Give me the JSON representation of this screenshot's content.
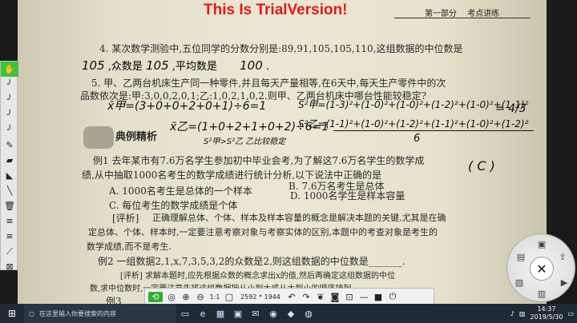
{
  "watermark": "This Is TrialVersion!",
  "header": {
    "section": "第一部分",
    "title": "考点讲练"
  },
  "page": {
    "q4_text": "4. 某次数学测验中,五位同学的分数分别是:89,91,105,105,110,这组数据的中位数是",
    "q4_median": "105",
    "q4_mode_label": ",众数是",
    "q4_mode": "105",
    "q4_mean_label": ",平均数是",
    "q4_mean": "100",
    "q4_end": ".",
    "q5_text": "5. 甲、乙两台机床生产同一种零件,并且每天产量相等,在6天中,每天生产零件中的次",
    "q5_text2": "品数依次是:甲:3,0,0,2,0,1;乙:1,0,2,1,0,2.则甲、乙两台机床中哪台性能较稳定?",
    "hw_line1": "x̄甲=(3+0+0+2+0+1)÷6=1",
    "hw_formula1": "S²甲=(1-3)²+(1-0)²+(1-0)²+(1-2)²+(1-0)²+(1-1)²",
    "hw_fraction1": "= 4/3",
    "hw_line2": "x̄乙=(1+0+2+1+0+2)÷6=1",
    "hw_formula2": "S²乙=(1-1)²+(1-0)²+(1-2)²+(1-1)²+(1-0)²+(1-2)²",
    "hw_denominator": "6",
    "hw_note": "S²甲>S²乙 乙比较稳定",
    "section_label": "典例精析",
    "ex1_text": "例1  去年某市有7.6万名学生参加初中毕业会考,为了解这7.6万名学生的数学成",
    "ex1_text2": "绩,从中抽取1000名考生的数学成绩进行统计分析,以下说法中正确的是",
    "ex1_answer": "( C )",
    "ex1_a": "A. 1000名考生是总体的一个样本",
    "ex1_b": "B. 7.6万名考生是总体",
    "ex1_c": "C. 每位考生的数学成绩是个体",
    "ex1_d": "D. 1000名学生是样本容量",
    "analysis_label": "[评析]",
    "analysis1": "正确理解总体、个体、样本及样本容量的概念是解决本题的关键,尤其是在确",
    "analysis2": "定总体、个体、样本时,一定要注意考察对象与考察实体的区别,本题中的考查对象是考生的",
    "analysis3": "数学成绩,而不是考生.",
    "ex2_text": "例2  一组数据2,1,x,7,3,5,3,2的众数是2,则这组数据的中位数是_______.",
    "analysis_ex2": "[评析]  求解本题时,应先根据众数的概念求出x的值,然后再确定这组数据的中位",
    "analysis_ex2b": "数,求中位数时,一定要注意先将这组数据按从小到大或从大到小的顺序排列.",
    "ex3_text": "例3"
  },
  "left_toolbar": {
    "items": [
      "hand-icon",
      "pen-icon",
      "pen-icon",
      "pen-icon",
      "pen-icon",
      "brush-icon",
      "highlighter-icon",
      "marker-icon",
      "line-icon",
      "eraser-icon",
      "menu-icon",
      "menu-icon",
      "pipette-icon",
      "shrink-icon",
      "save-icon"
    ]
  },
  "bottom_toolbar": {
    "zoom_label": "1:1",
    "resolution": "2592 * 1944"
  },
  "taskbar": {
    "search_placeholder": "在这里输入你要搜索的内容",
    "time": "14:37",
    "date": "2019/5/30"
  },
  "colors": {
    "watermark": "#e31a1a",
    "toolbar_active": "#3ec23e",
    "taskbar_bg": "#1f2a36"
  }
}
